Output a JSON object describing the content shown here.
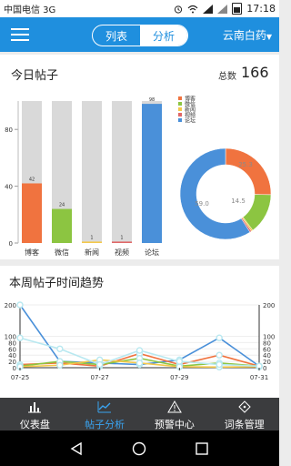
{
  "status_bar": {
    "carrier": "中国电信 3G",
    "time": "17:18"
  },
  "header": {
    "tabs": [
      {
        "label": "列表"
      },
      {
        "label": "分析"
      }
    ],
    "active_tab": 1,
    "company": "云南白药",
    "accent": "#1f8fde"
  },
  "today": {
    "title": "今日帖子",
    "total_label": "总数",
    "total_value": "166"
  },
  "weekly": {
    "title": "本周帖子时间趋势"
  },
  "tabbar": {
    "items": [
      {
        "label": "仪表盘",
        "icon": "dashboard-icon"
      },
      {
        "label": "帖子分析",
        "icon": "chart-icon"
      },
      {
        "label": "预警中心",
        "icon": "warning-icon"
      },
      {
        "label": "词条管理",
        "icon": "tag-icon"
      }
    ],
    "active_index": 1
  },
  "chart_data": [
    {
      "type": "bar",
      "categories": [
        "博客",
        "微信",
        "新闻",
        "视频",
        "论坛"
      ],
      "values": [
        42,
        24,
        1,
        1,
        98
      ],
      "colors": [
        "#f0733f",
        "#8cc541",
        "#f4c84a",
        "#e06767",
        "#4a90d9"
      ],
      "background_bar_max": 100,
      "yticks": [
        0,
        40,
        80
      ],
      "ylim": [
        0,
        100
      ]
    },
    {
      "type": "pie",
      "donut": true,
      "labels": [
        "博客",
        "微信",
        "新闻",
        "视频",
        "论坛"
      ],
      "values": [
        42,
        24,
        1,
        1,
        98
      ],
      "colors": [
        "#f0733f",
        "#8cc541",
        "#f4c84a",
        "#e06767",
        "#4a90d9"
      ],
      "legend_position": "top",
      "slice_labels": [
        "25.3",
        "14.5",
        "59.0"
      ]
    },
    {
      "type": "line",
      "x": [
        "07-25",
        "07-26",
        "07-27",
        "07-28",
        "07-29",
        "07-30",
        "07-31"
      ],
      "xtick_labels": [
        "07-25",
        "07-27",
        "07-29",
        "07-31"
      ],
      "yticks": [
        0,
        20,
        40,
        60,
        80,
        100,
        200
      ],
      "series": [
        {
          "color": "#4a90d9",
          "values": [
            200,
            20,
            15,
            10,
            25,
            95,
            5
          ]
        },
        {
          "color": "#f0733f",
          "values": [
            10,
            15,
            5,
            45,
            10,
            40,
            5
          ]
        },
        {
          "color": "#8cc541",
          "values": [
            5,
            20,
            10,
            30,
            5,
            15,
            5
          ]
        },
        {
          "color": "#f4c84a",
          "values": [
            3,
            8,
            25,
            15,
            3,
            2,
            3
          ]
        },
        {
          "color": "#b8e8f0",
          "values": [
            95,
            60,
            10,
            55,
            20,
            10,
            5
          ]
        }
      ]
    }
  ]
}
